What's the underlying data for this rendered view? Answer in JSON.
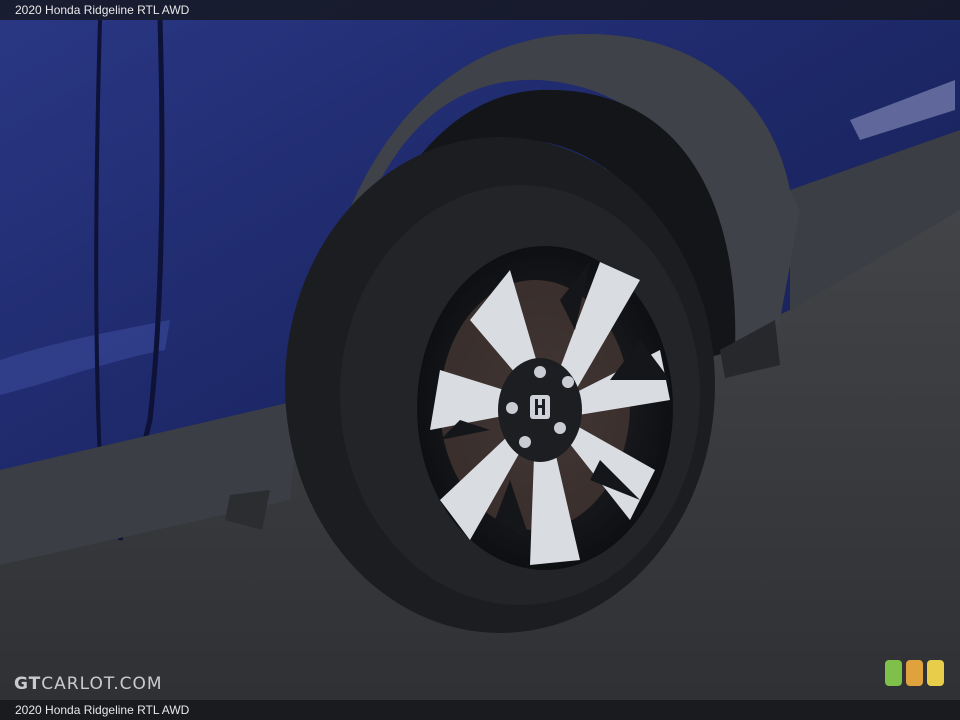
{
  "header": {
    "title": "2020 Honda Ridgeline RTL AWD"
  },
  "footer": {
    "caption": "2020 Honda Ridgeline RTL AWD"
  },
  "watermark": {
    "prefix": "GT",
    "brand": "CARLOT.COM"
  },
  "colors": {
    "body_paint": "#1f2a6b",
    "cladding": "#3d4046",
    "asphalt": "#3a3c40",
    "tire": "#1c1d20",
    "wheel_silver": "#d9dde2",
    "wheel_black": "#15161a",
    "badge_green": "#7ec04a",
    "badge_orange": "#e0a23c",
    "badge_yellow": "#e8cd4a"
  },
  "icons": {
    "badge": "traffic-light-badge-icon",
    "logo": "honda-h-logo-icon"
  }
}
